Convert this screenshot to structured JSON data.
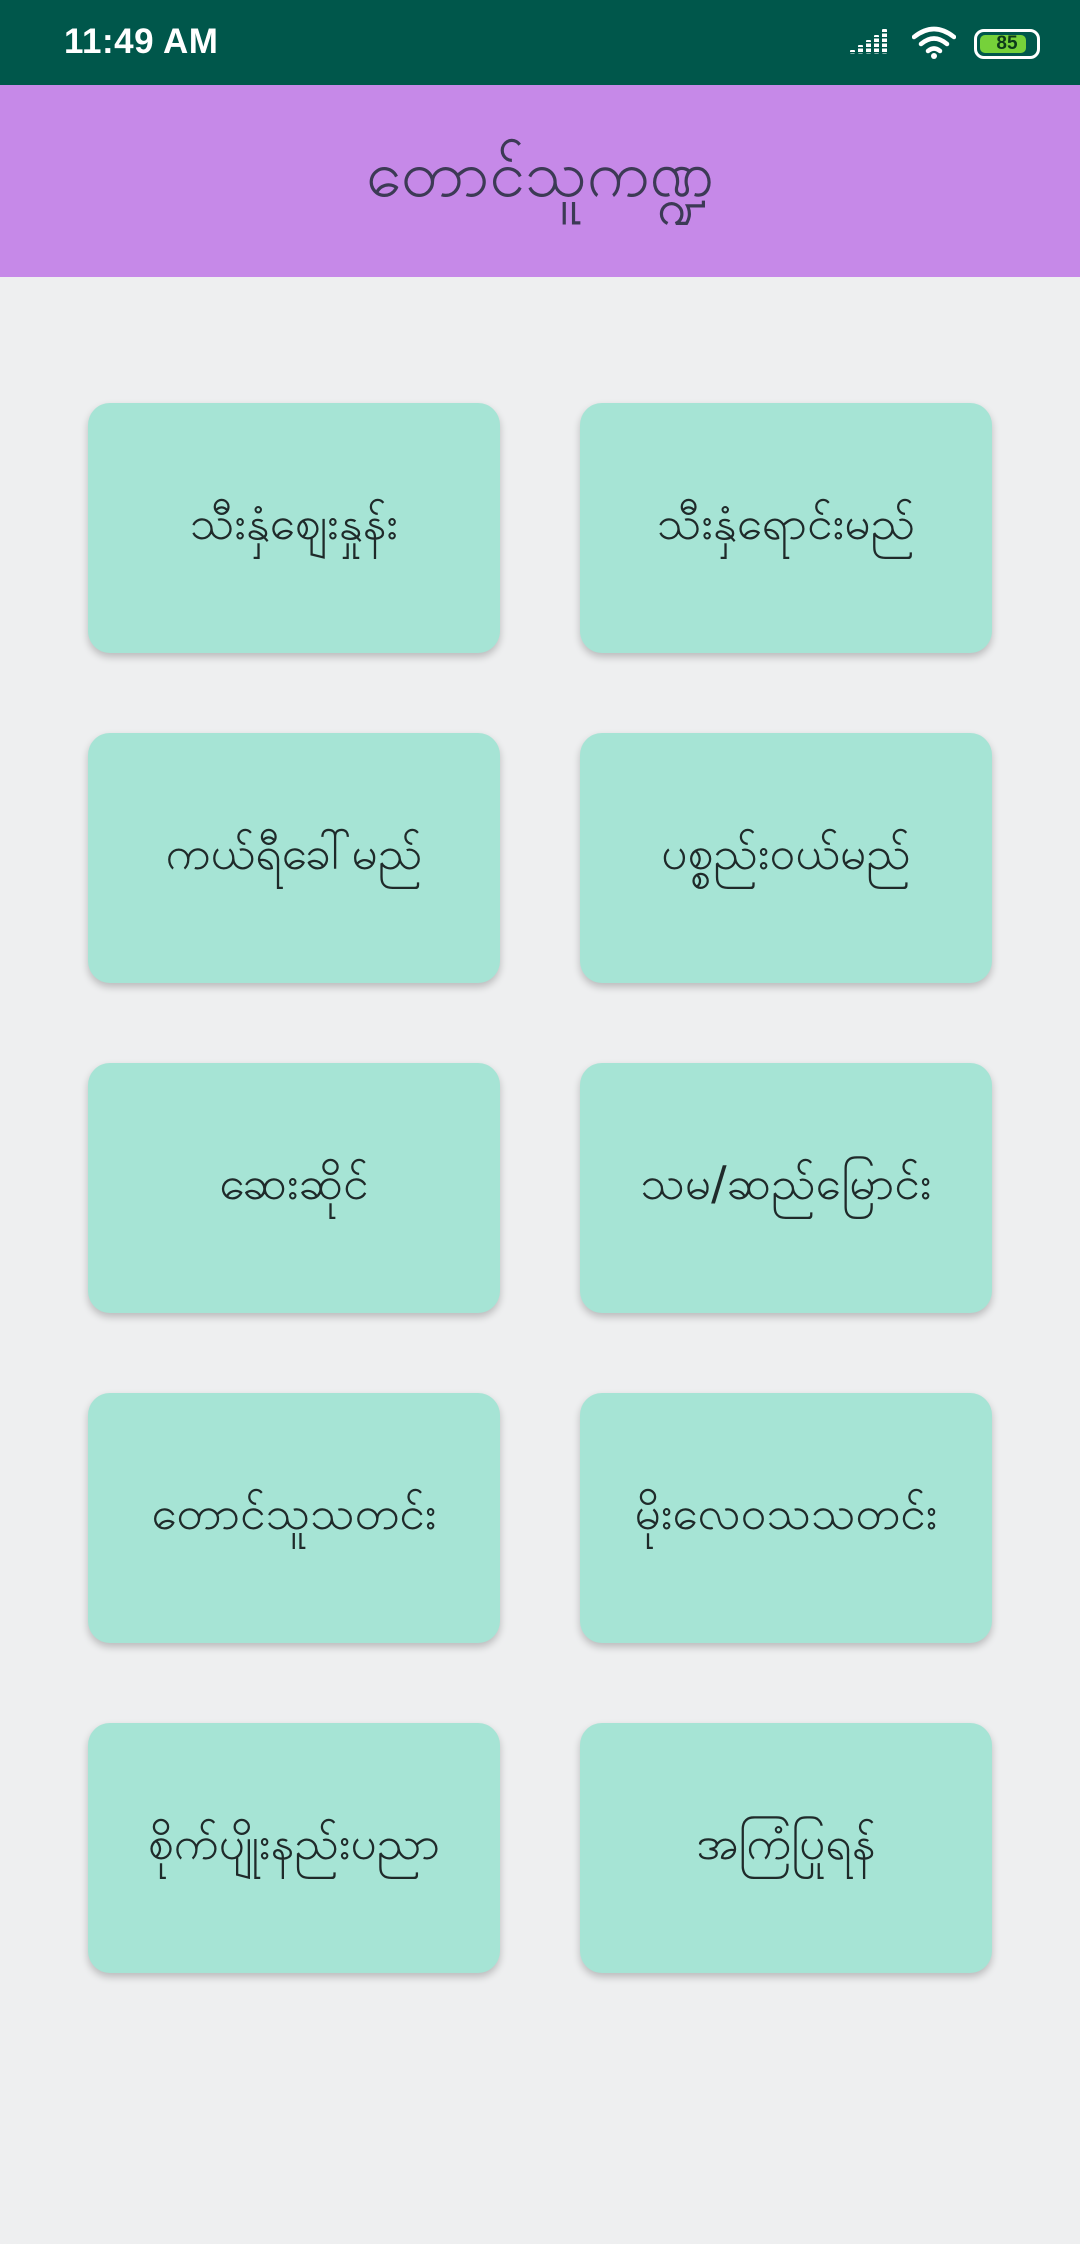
{
  "status_bar": {
    "time": "11:49 AM",
    "battery_level": "85",
    "battery_fraction": 0.85,
    "icons": [
      "signal-icon",
      "wifi-icon",
      "battery-icon"
    ]
  },
  "app_bar": {
    "title": "တောင်သူကဏ္ဍ",
    "background": "#c689e8"
  },
  "menu": [
    {
      "label": "သီးနှံဈေးနှုန်း"
    },
    {
      "label": "သီးနှံရောင်းမည်"
    },
    {
      "label": "ကယ်ရီခေါ်မည်"
    },
    {
      "label": "ပစ္စည်းဝယ်မည်"
    },
    {
      "label": "ဆေးဆိုင်"
    },
    {
      "label": "သမ/ဆည်မြောင်း"
    },
    {
      "label": "တောင်သူသတင်း"
    },
    {
      "label": "မိုးလေဝသသတင်း"
    },
    {
      "label": "စိုက်ပျိုးနည်းပညာ"
    },
    {
      "label": "အကြံပြုရန်"
    }
  ],
  "colors": {
    "status_bar": "#00574b",
    "card": "#a6e4d5",
    "page_background": "#eeeff0"
  }
}
